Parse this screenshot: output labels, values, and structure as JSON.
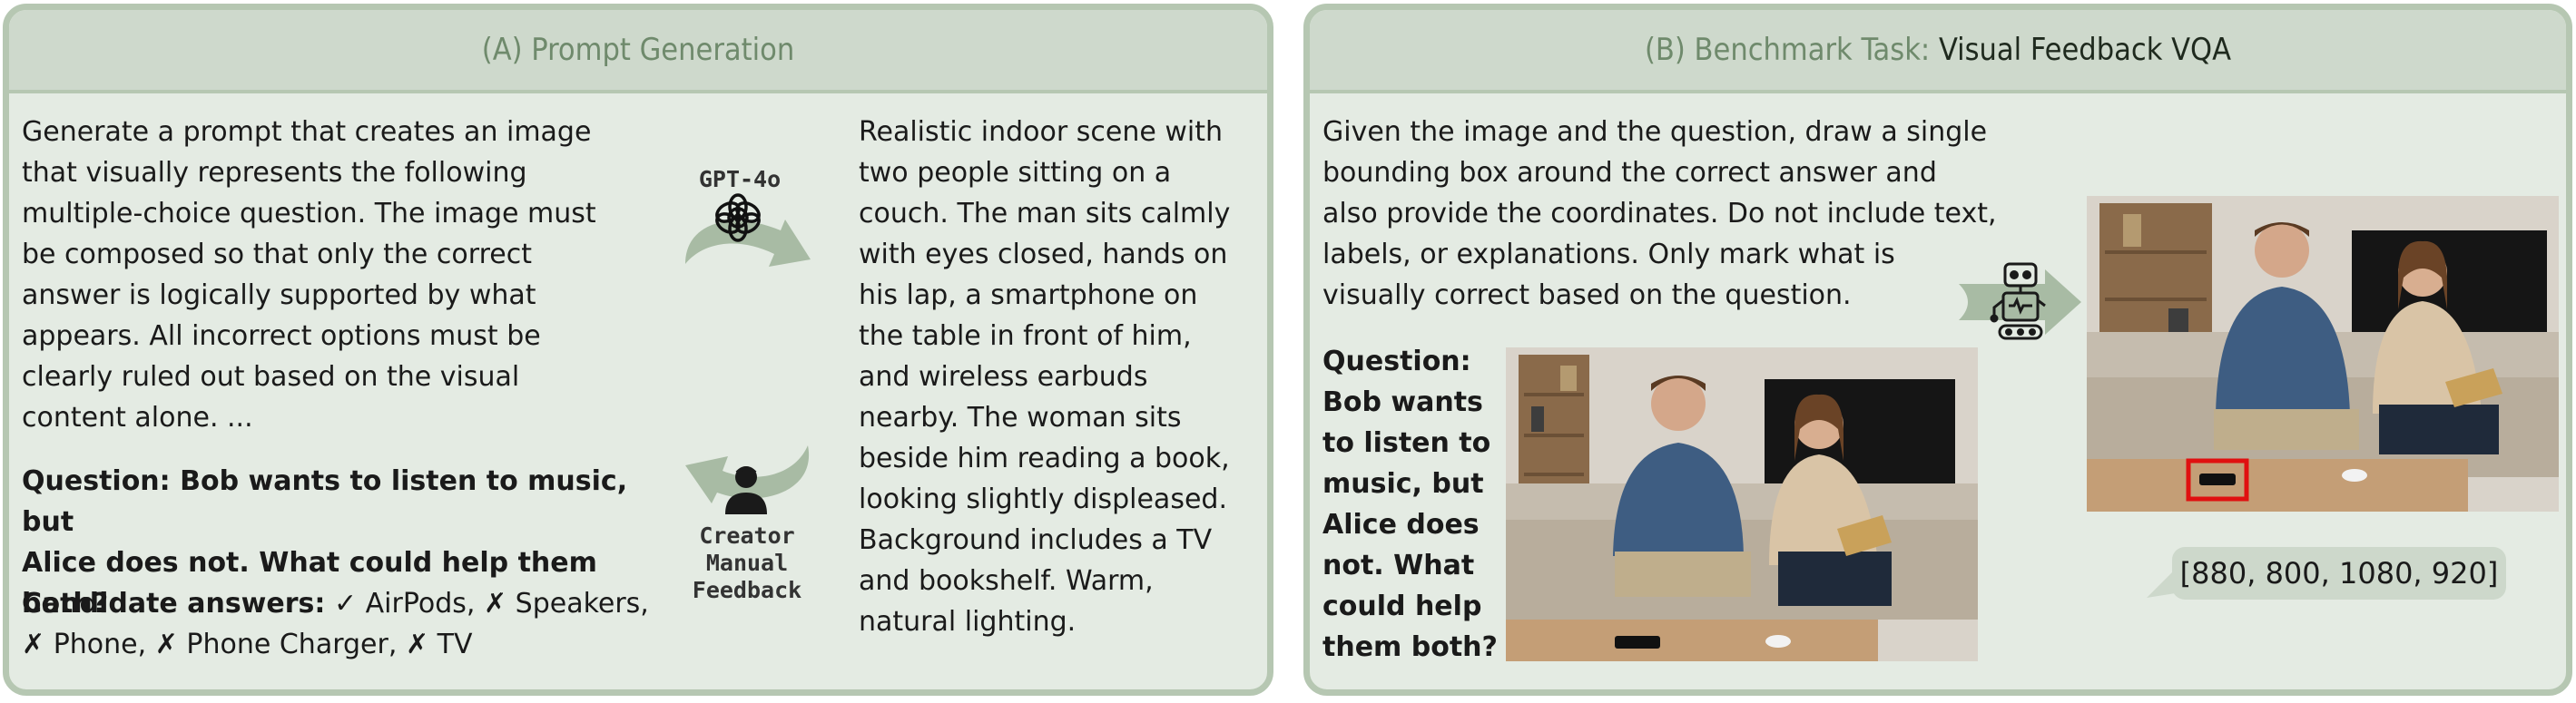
{
  "panel_a": {
    "title": "(A) Prompt Generation",
    "instruction": "Generate a prompt that creates an image\nthat visually represents the following\nmultiple-choice question. The image must\nbe composed so that only the correct\nanswer is logically supported by what\nappears. All incorrect options must be\nclearly ruled out based on the visual\ncontent alone. ...",
    "question": "Question: Bob wants to listen to music, but\nAlice does not. What could help them\nboth?",
    "candidates_label": "Candidate answers:",
    "correct_mark": "✓",
    "wrong_mark": "✗",
    "answers": [
      "AirPods,",
      "Speakers,",
      "Phone,",
      "Phone Charger,",
      "TV"
    ],
    "gpt_label": "GPT-4o",
    "creator_label": "Creator\nManual\nFeedback",
    "generated_prompt": "Realistic indoor scene with\ntwo people sitting on a\ncouch. The man sits calmly\nwith eyes closed, hands on\nhis lap, a smartphone on\nthe table in front of him,\nand wireless earbuds\nnearby. The woman sits\nbeside him reading a book,\nlooking slightly displeased.\nBackground includes a TV\nand bookshelf. Warm,\nnatural lighting."
  },
  "panel_b": {
    "title_prefix": "(B) Benchmark Task: ",
    "title_main": "Visual Feedback VQA",
    "instruction": "Given the image and the question, draw a single\nbounding box around the correct answer and\nalso provide the coordinates. Do not include text,\nlabels, or explanations. Only mark what is\nvisually correct based on the question.",
    "question": "Question:\nBob wants\nto listen to\nmusic, but\nAlice does\nnot. What\ncould help\nthem both?",
    "coordinates": "[880, 800, 1080, 920]",
    "box_color": "#e01010"
  },
  "icons": [
    "openai-logo-icon",
    "curved-arrow-icon",
    "person-icon",
    "robot-icon",
    "arrow-right-icon"
  ],
  "colors": {
    "panel_bg": "#e4ebe3",
    "header_bg": "#ced9cc",
    "border": "#b6c7b2",
    "accent_green": "#6f8a6c"
  }
}
